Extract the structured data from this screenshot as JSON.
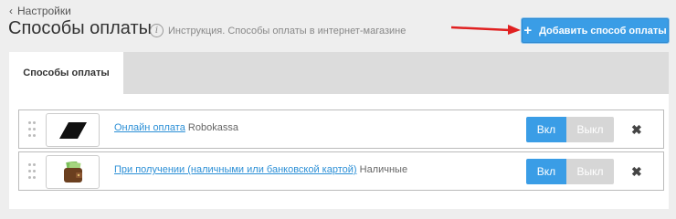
{
  "nav": {
    "back_label": "Настройки"
  },
  "header": {
    "title": "Способы оплаты",
    "help_text": "Инструкция. Способы оплаты в интернет-магазине",
    "add_button_label": "Добавить способ оплаты"
  },
  "tabs": [
    {
      "label": "Способы оплаты"
    }
  ],
  "methods": [
    {
      "name": "Онлайн оплата",
      "provider": "Robokassa",
      "logo_icon": "robokassa-logo-icon",
      "on_label": "Вкл",
      "off_label": "Выкл",
      "enabled": true
    },
    {
      "name": "При получении (наличными или банковской картой)",
      "provider": "Наличные",
      "logo_icon": "wallet-icon",
      "on_label": "Вкл",
      "off_label": "Выкл",
      "enabled": true
    }
  ],
  "colors": {
    "accent": "#3a9de6",
    "arrow": "#e02020",
    "link": "#2b8fd6"
  }
}
